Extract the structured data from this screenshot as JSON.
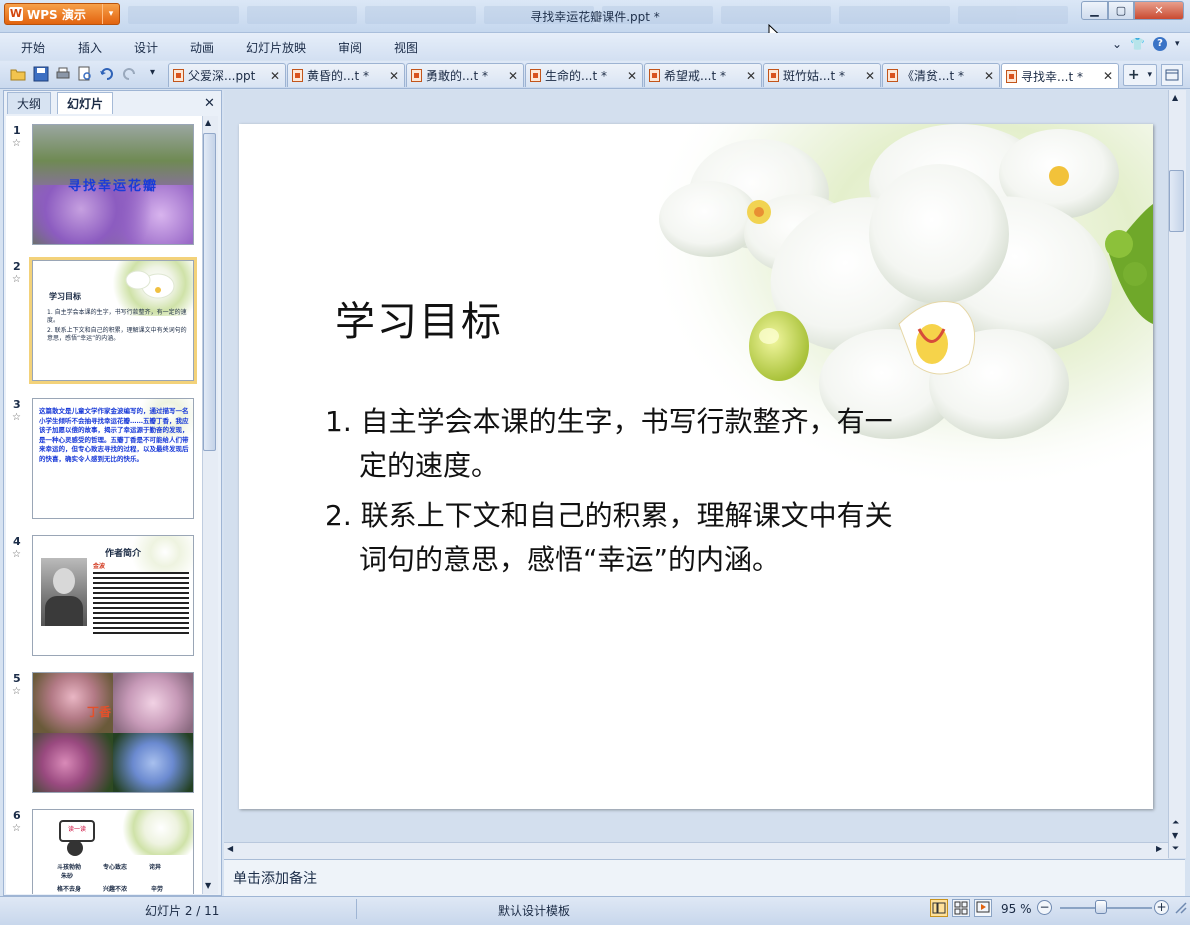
{
  "app": {
    "name": "WPS 演示",
    "window_title": "寻找幸运花瓣课件.ppt *"
  },
  "menu": [
    "开始",
    "插入",
    "设计",
    "动画",
    "幻灯片放映",
    "审阅",
    "视图"
  ],
  "tabs": [
    {
      "label": "父爱深...ppt"
    },
    {
      "label": "黄昏的...t *"
    },
    {
      "label": "勇敢的...t *"
    },
    {
      "label": "生命的...t *"
    },
    {
      "label": "希望戒...t *"
    },
    {
      "label": "斑竹姑...t *"
    },
    {
      "label": "《清贫...t *"
    },
    {
      "label": "寻找幸...t *"
    }
  ],
  "panel": {
    "tab_outline": "大纲",
    "tab_slides": "幻灯片"
  },
  "thumbnails": [
    {
      "num": "1",
      "title": "寻找幸运花瓣"
    },
    {
      "num": "2",
      "title": "学习目标",
      "line1": "1. 自主学会本课的生字，书写行款整齐，有一定的速度。",
      "line2": "2. 联系上下文和自己的积累，理解课文中有关词句的意思，感悟“幸运”的内涵。"
    },
    {
      "num": "3",
      "text": "这篇散文是儿童文学作家金波编写的，通过描写一名小学生倾听不会抽寻找幸运花瓣……五瓣丁香，我应该子加愿以偿的故事，揭示了幸运源于勤奋的发现，是一种心灵感受的哲理。五瓣丁香是不可能给人们带来幸运的，但专心致志寻找的过程，以及最终发现后的快喜，确实令人感到无比的快乐。"
    },
    {
      "num": "4",
      "title": "作者简介",
      "label": "金波"
    },
    {
      "num": "5",
      "label": "丁香"
    },
    {
      "num": "6",
      "sign": "读一读",
      "words": [
        "斗孩勃勃",
        "专心致志",
        "诧异",
        "朱砂",
        "格不去身",
        "兴趣不浓",
        "辛劳"
      ]
    }
  ],
  "slide": {
    "title": "学习目标",
    "item1_line1": "1.  自主学会本课的生字，书写行款整齐，有一",
    "item1_line2": "定的速度。",
    "item2_line1": "2.  联系上下文和自己的积累，理解课文中有关",
    "item2_line2": "词句的意思，感悟“幸运”的内涵。"
  },
  "notes_placeholder": "单击添加备注",
  "status": {
    "slide_indicator": "幻灯片 2 / 11",
    "template": "默认设计模板",
    "zoom": "95 %"
  },
  "colors": {
    "accent_orange": "#e2630f",
    "chrome_blue": "#c5d7ee",
    "thumb_blue_text": "#1a3bd8"
  }
}
